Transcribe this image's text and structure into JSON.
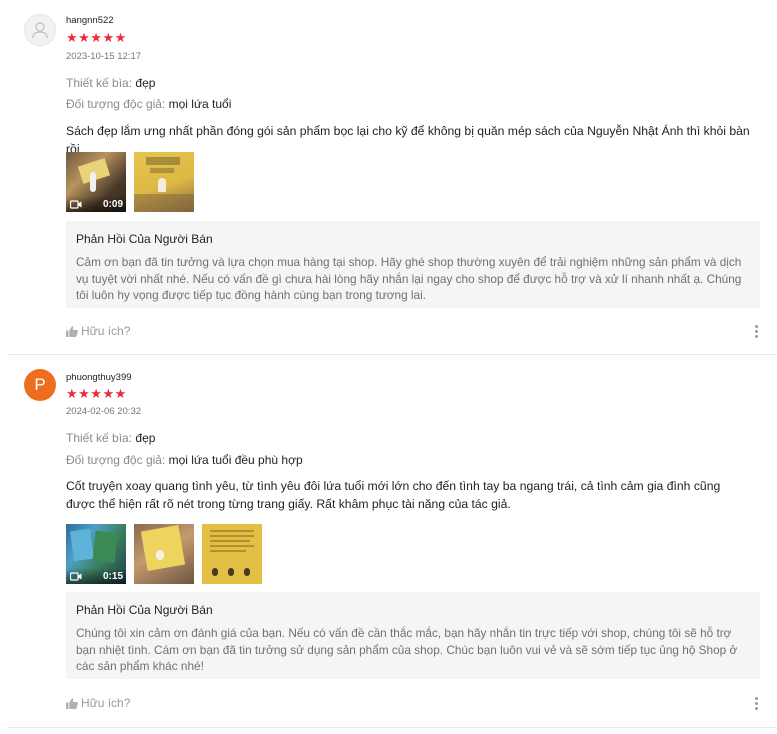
{
  "reviews": [
    {
      "avatar_letter": "",
      "username": "hangnn522",
      "stars": "★★★★★",
      "rating": 5,
      "date": "2023-10-15 12:17",
      "attrs": [
        {
          "key": "Thiết kế bìa:",
          "value": "đẹp"
        },
        {
          "key": "Đối tượng độc giả:",
          "value": "mọi lứa tuổi"
        }
      ],
      "body": "Sách đẹp lắm ưng nhất phần đóng gói sản phẩm bọc lại cho kỹ để không bị quăn mép sách của Nguyễn Nhật Ánh thì khỏi bàn rồi",
      "video_duration": "0:09",
      "reply_title": "Phản Hồi Của Người Bán",
      "reply_text": "Cảm ơn bạn đã tin tưởng và lựa chọn mua hàng tại shop. Hãy ghé shop thường xuyên để trải nghiệm những sản phẩm và dịch vụ tuyệt vời nhất nhé. Nếu có vấn đề gì chưa hài lòng hãy nhắn lại ngay cho shop để được hỗ trợ và xử lí nhanh nhất ạ. Chúng tôi luôn hy vọng được tiếp tục đồng hành cùng bạn trong tương lai.",
      "helpful": "Hữu ích?"
    },
    {
      "avatar_letter": "P",
      "username": "phuongthuy399",
      "stars": "★★★★★",
      "rating": 5,
      "date": "2024-02-06 20:32",
      "attrs": [
        {
          "key": "Thiết kế bìa:",
          "value": "đẹp"
        },
        {
          "key": "Đối tượng độc giả:",
          "value": "mọi lứa tuổi đều phù hợp"
        }
      ],
      "body": "Cốt truyện xoay quang tình yêu, từ tình yêu đôi lứa tuổi mới lớn cho đến tình tay ba ngang trái, cả tình cảm gia đình cũng được thể hiện rất rõ nét trong từng trang giấy. Rất khâm phục tài năng của tác giả.",
      "video_duration": "0:15",
      "reply_title": "Phản Hồi Của Người Bán",
      "reply_text": "Chúng tôi  xin cảm ơn đánh giá của bạn. Nếu có vấn đề cần thắc mắc, bạn hãy nhắn tin trực tiếp với shop, chúng tôi sẽ hỗ trợ bạn nhiệt tình. Cám ơn bạn đã tin tưởng sử dụng sản phẩm của shop. Chúc bạn luôn vui vẻ và sẽ sớm tiếp tục ủng hộ Shop ở các sản phẩm khác nhé!",
      "helpful": "Hữu ích?"
    }
  ],
  "colors": {
    "star": "#ee2a38",
    "avatar_orange": "#ee6e1f",
    "reply_bg": "#f5f5f5",
    "muted": "#757575"
  }
}
